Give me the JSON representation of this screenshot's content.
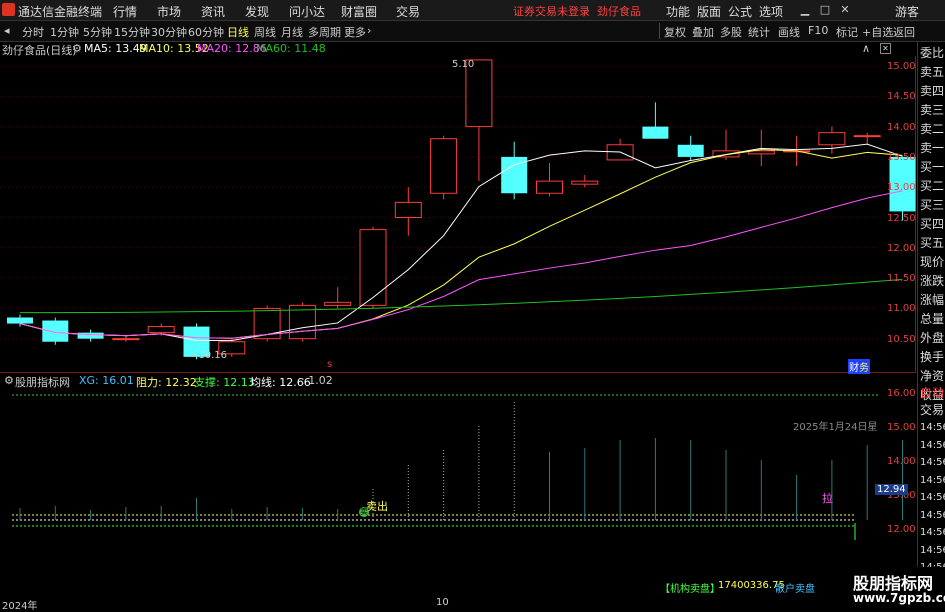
{
  "menubar": {
    "app_title": "通达信金融终端",
    "menus": [
      "行情",
      "市场",
      "资讯",
      "发现",
      "问小达",
      "财富圈",
      "交易"
    ],
    "status_text": "证券交易未登录",
    "stock_name": "劲仔食品",
    "right_menus": [
      "功能",
      "版面",
      "公式",
      "选项"
    ],
    "guest": "游客"
  },
  "periodbar": {
    "periods": [
      "分时",
      "1分钟",
      "5分钟",
      "15分钟",
      "30分钟",
      "60分钟",
      "日线",
      "周线",
      "月线",
      "多周期",
      "更多"
    ],
    "active": "日线",
    "tools": [
      "复权",
      "叠加",
      "多股",
      "统计",
      "画线",
      "F10",
      "标记",
      "+自选",
      "返回"
    ]
  },
  "ma_legend": {
    "title": "劲仔食品(日线)",
    "ma5": "MA5: 13.49",
    "ma10": "MA10: 13.52",
    "ma20": "MA20: 12.86",
    "ma60": "MA60: 11.48",
    "colors": {
      "ma5": "#ffffff",
      "ma10": "#ffff54",
      "ma20": "#ff54ff",
      "ma60": "#20c020"
    }
  },
  "price_axis": [
    "15.00",
    "14.50",
    "14.00",
    "13.50",
    "13.00",
    "12.50",
    "12.00",
    "11.50",
    "11.00",
    "10.50"
  ],
  "annotations": {
    "high": "5.10",
    "low": "←10.16",
    "s_mark": "s",
    "cai": "财",
    "cai_color": "#4040ff"
  },
  "indicator": {
    "name": "股朋指标网",
    "xg": "XG: 16.01",
    "zuli": "阻力: 12.32",
    "zhicheng": "支撑: 12.13",
    "junxian": "均线: 12.66",
    "extra": ": 1.02",
    "date_text": "2025年1月24日星",
    "axis": [
      "16.00",
      "15.00",
      "14.00",
      "13.00",
      "12.00"
    ],
    "current_value": "12.94",
    "maichu": "卖出",
    "la": "拉",
    "jigou": "【机构卖盘】",
    "jigou_value": "17400336.75",
    "sanhu": "散户卖盘"
  },
  "right_panel": {
    "items": [
      "委比",
      "卖五",
      "卖四",
      "卖三",
      "卖二",
      "卖一",
      "买一",
      "买二",
      "买三",
      "买四",
      "买五",
      "现价",
      "涨跌",
      "涨幅",
      "总量",
      "外盘",
      "换手",
      "净资",
      "收益"
    ],
    "items2": [
      "自动",
      "交易"
    ],
    "times": [
      "14:56",
      "14:56",
      "14:56",
      "14:56",
      "14:56",
      "14:56",
      "14:56",
      "14:56",
      "14:56"
    ]
  },
  "timeaxis": {
    "year": "2024年",
    "month": "10"
  },
  "watermark": {
    "line1": "股朋指标网",
    "line2": "www.7gpzb.com"
  },
  "chart_data": {
    "type": "candlestick",
    "candles": [
      {
        "o": 10.85,
        "c": 10.75,
        "h": 10.9,
        "l": 10.7
      },
      {
        "o": 10.8,
        "c": 10.45,
        "h": 10.85,
        "l": 10.4
      },
      {
        "o": 10.6,
        "c": 10.5,
        "h": 10.65,
        "l": 10.45
      },
      {
        "o": 10.5,
        "c": 10.5,
        "h": 10.55,
        "l": 10.45
      },
      {
        "o": 10.6,
        "c": 10.7,
        "h": 10.75,
        "l": 10.55
      },
      {
        "o": 10.7,
        "c": 10.2,
        "h": 10.75,
        "l": 10.16
      },
      {
        "o": 10.25,
        "c": 10.45,
        "h": 10.5,
        "l": 10.2
      },
      {
        "o": 10.5,
        "c": 11.0,
        "h": 11.05,
        "l": 10.45
      },
      {
        "o": 10.5,
        "c": 11.05,
        "h": 11.1,
        "l": 10.45
      },
      {
        "o": 11.05,
        "c": 11.1,
        "h": 11.35,
        "l": 11.0
      },
      {
        "o": 11.05,
        "c": 12.3,
        "h": 12.35,
        "l": 11.0
      },
      {
        "o": 12.5,
        "c": 12.75,
        "h": 13.0,
        "l": 12.2
      },
      {
        "o": 12.9,
        "c": 13.8,
        "h": 13.85,
        "l": 12.8
      },
      {
        "o": 14.0,
        "c": 15.1,
        "h": 15.1,
        "l": 13.1
      },
      {
        "o": 13.5,
        "c": 12.9,
        "h": 13.75,
        "l": 12.8
      },
      {
        "o": 12.9,
        "c": 13.1,
        "h": 13.4,
        "l": 12.85
      },
      {
        "o": 13.05,
        "c": 13.1,
        "h": 13.2,
        "l": 13.0
      },
      {
        "o": 13.45,
        "c": 13.7,
        "h": 13.8,
        "l": 13.45
      },
      {
        "o": 14.0,
        "c": 13.8,
        "h": 14.4,
        "l": 13.8
      },
      {
        "o": 13.7,
        "c": 13.5,
        "h": 13.85,
        "l": 13.45
      },
      {
        "o": 13.5,
        "c": 13.6,
        "h": 13.95,
        "l": 13.45
      },
      {
        "o": 13.55,
        "c": 13.6,
        "h": 13.95,
        "l": 13.35
      },
      {
        "o": 13.6,
        "c": 13.6,
        "h": 13.85,
        "l": 13.35
      },
      {
        "o": 13.7,
        "c": 13.9,
        "h": 14.0,
        "l": 13.55
      },
      {
        "o": 13.85,
        "c": 13.85,
        "h": 13.9,
        "l": 13.7
      },
      {
        "o": 13.5,
        "c": 12.6,
        "h": 13.5,
        "l": 12.45
      }
    ]
  }
}
